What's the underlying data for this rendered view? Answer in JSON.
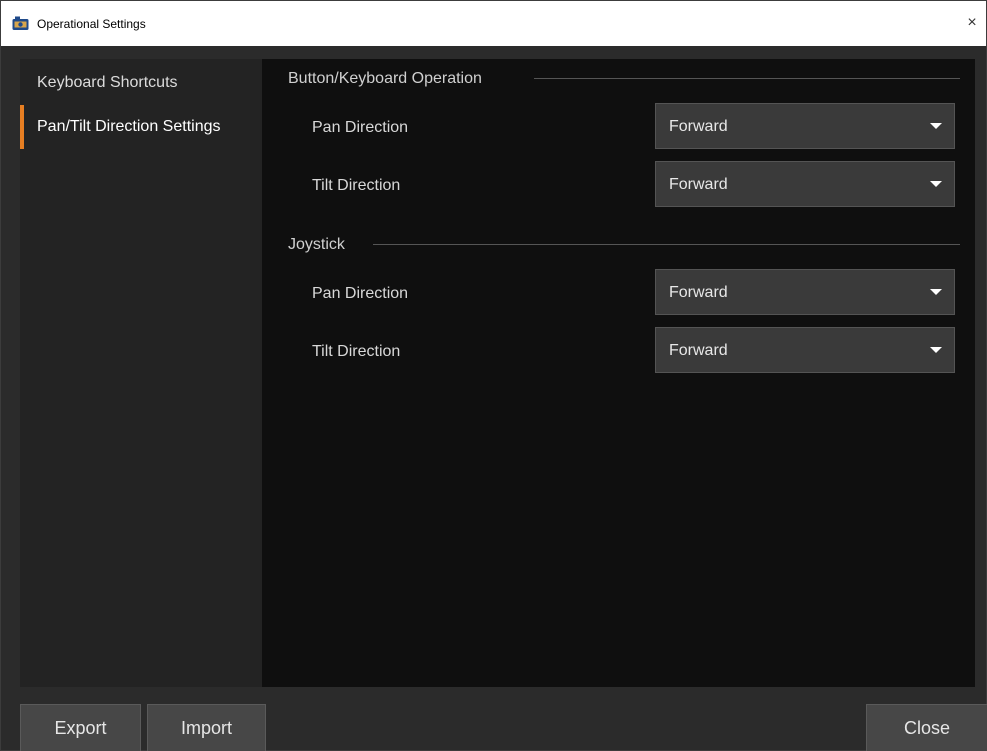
{
  "window": {
    "title": "Operational Settings",
    "close_glyph": "×",
    "app_icon": "camera-app-icon"
  },
  "sidebar": {
    "items": [
      {
        "label": "Keyboard Shortcuts",
        "active": false
      },
      {
        "label": "Pan/Tilt Direction Settings",
        "active": true
      }
    ]
  },
  "sections": [
    {
      "title": "Button/Keyboard Operation",
      "rows": [
        {
          "label": "Pan Direction",
          "value": "Forward"
        },
        {
          "label": "Tilt Direction",
          "value": "Forward"
        }
      ]
    },
    {
      "title": "Joystick",
      "rows": [
        {
          "label": "Pan Direction",
          "value": "Forward"
        },
        {
          "label": "Tilt Direction",
          "value": "Forward"
        }
      ]
    }
  ],
  "footer": {
    "export_label": "Export",
    "import_label": "Import",
    "close_label": "Close"
  },
  "colors": {
    "accent": "#e67e22",
    "panel": "#0f0f0f",
    "sidebar": "#232323"
  }
}
